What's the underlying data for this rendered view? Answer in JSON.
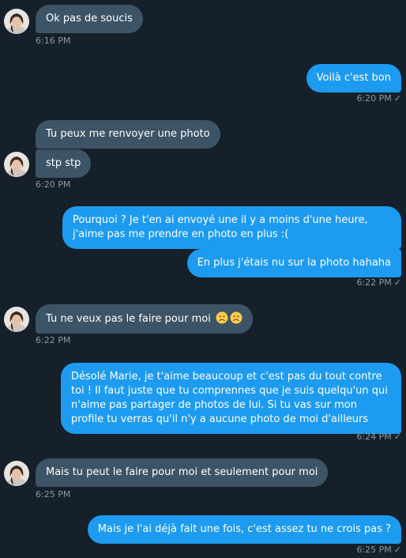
{
  "colors": {
    "background": "#15202b",
    "incoming_bubble": "#3d5466",
    "outgoing_bubble": "#1d9bf0",
    "timestamp": "#8b98a5"
  },
  "check_icon": "✓",
  "messages": [
    {
      "direction": "incoming",
      "text": "Ok pas de soucis",
      "time": "6:16 PM"
    },
    {
      "direction": "outgoing",
      "text": "Voilà c'est bon",
      "time": "6:20 PM"
    },
    {
      "direction": "incoming",
      "text": "Tu peux me renvoyer une photo"
    },
    {
      "direction": "incoming",
      "text": "stp stp",
      "time": "6:20 PM"
    },
    {
      "direction": "outgoing",
      "text": "Pourquoi ? Je t'en ai envoyé une il y a moins d'une heure, j'aime pas me prendre en photo en plus :("
    },
    {
      "direction": "outgoing",
      "text": "En plus j'étais nu sur la photo hahaha",
      "time": "6:22 PM"
    },
    {
      "direction": "incoming",
      "text": "Tu ne veux pas le faire pour moi",
      "emoji": [
        "frowning-face",
        "frowning-face"
      ],
      "time": "6:22 PM"
    },
    {
      "direction": "outgoing",
      "text": "Désolé Marie, je t'aime beaucoup et c'est pas du tout contre toi ! Il faut juste que tu comprennes que je suis quelqu'un qui n'aime pas partager de photos de lui. Si tu vas sur mon profile tu verras qu'il n'y a aucune photo de moi d'ailleurs",
      "time": "6:24 PM"
    },
    {
      "direction": "incoming",
      "text": "Mais tu peut le faire pour moi et seulement pour moi",
      "time": "6:25 PM"
    },
    {
      "direction": "outgoing",
      "text": "Mais je l'ai déjà fait une fois, c'est assez tu ne crois pas ?",
      "time": "6:25 PM"
    }
  ]
}
